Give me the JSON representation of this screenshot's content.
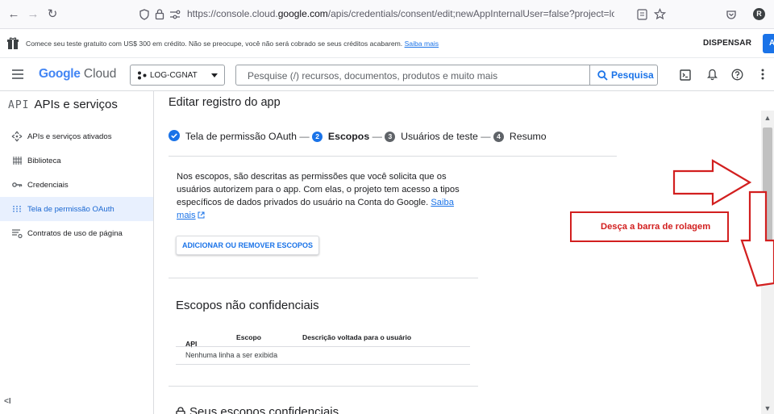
{
  "browser": {
    "url_prefix": "https://console.cloud.",
    "url_domain": "google.com",
    "url_path": "/apis/credentials/consent/edit;newAppInternalUser=false?project=log-cgnat&supportedPurview=project",
    "profile_initial": "R"
  },
  "promo": {
    "text": "Comece seu teste gratuito com US$ 300 em crédito. Não se preocupe, você não será cobrado se seus créditos acabarem.",
    "link": "Saiba mais",
    "dismiss": "DISPENSAR",
    "cta": "A"
  },
  "header": {
    "logo_google": "Google",
    "logo_cloud": "Cloud",
    "project": "LOG-CGNAT",
    "search_placeholder": "Pesquise (/) recursos, documentos, produtos e muito mais",
    "search_button": "Pesquisa"
  },
  "sidebar": {
    "icon_text": "API",
    "title": "APIs e serviços",
    "items": [
      {
        "label": "APIs e serviços ativados",
        "icon": "diamond-icon"
      },
      {
        "label": "Biblioteca",
        "icon": "library-icon"
      },
      {
        "label": "Credenciais",
        "icon": "key-icon"
      },
      {
        "label": "Tela de permissão OAuth",
        "icon": "consent-icon",
        "active": true
      },
      {
        "label": "Contratos de uso de página",
        "icon": "settings-list-icon"
      }
    ],
    "collapse": "<I"
  },
  "main": {
    "title": "Editar registro do app",
    "steps": [
      {
        "num": "",
        "label": "Tela de permissão OAuth",
        "state": "done"
      },
      {
        "num": "2",
        "label": "Escopos",
        "state": "current"
      },
      {
        "num": "3",
        "label": "Usuários de teste",
        "state": "pending"
      },
      {
        "num": "4",
        "label": "Resumo",
        "state": "pending"
      }
    ],
    "description": "Nos escopos, são descritas as permissões que você solicita que os usuários autorizem para o app. Com elas, o projeto tem acesso a tipos específicos de dados privados do usuário na Conta do Google.",
    "description_link": "Saiba mais",
    "add_button": "ADICIONAR OU REMOVER ESCOPOS",
    "non_sensitive_title": "Escopos não confidenciais",
    "table": {
      "columns": [
        "API",
        "Escopo",
        "Descrição voltada para o usuário"
      ],
      "empty": "Nenhuma linha a ser exibida"
    },
    "sensitive_title": "Seus escopos confidenciais"
  },
  "annotation": {
    "text": "Desça a barra de rolagem",
    "color": "#d21f1f"
  },
  "colors": {
    "accent": "#1a73e8",
    "active_bg": "#e8f0fe"
  }
}
